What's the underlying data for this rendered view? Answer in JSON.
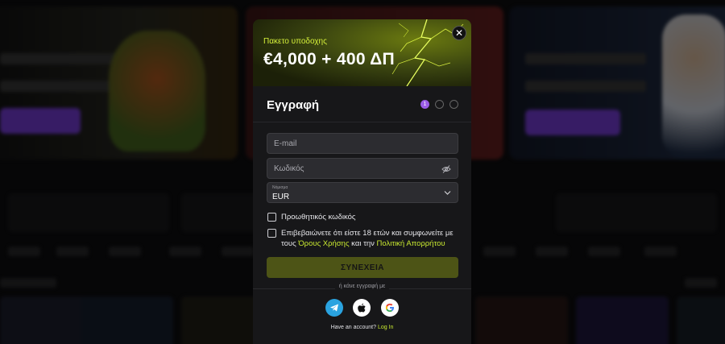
{
  "banner": {
    "subtitle": "Πακετο υποδοχης",
    "title": "€4,000 + 400 ΔΠ",
    "close_symbol": "✕"
  },
  "form": {
    "title": "Εγγραφή",
    "steps": [
      "1",
      "",
      ""
    ],
    "email_placeholder": "E-mail",
    "password_placeholder": "Κωδικός",
    "currency_label": "Νόμισμα",
    "currency_value": "EUR",
    "promo_label": "Προωθητικός κωδικός",
    "terms_text_1": "Επιβεβαιώνετε ότι είστε 18 ετών και συμφωνείτε με τους ",
    "terms_link_1": "Όρους Χρήσης",
    "terms_text_2": " και την ",
    "terms_link_2": "Πολιτική Απορρήτου",
    "continue_label": "ΣΥΝΕΧΕΙΑ"
  },
  "social": {
    "divider_text": "ή κάνε εγγραφή με",
    "providers": [
      "telegram-icon",
      "apple-icon",
      "google-icon"
    ]
  },
  "footer": {
    "account_text": "Have an account? ",
    "login_link": "Log In"
  },
  "colors": {
    "accent": "#c8e830",
    "step_active": "#9a5ce8",
    "continue_bg": "#4d5416"
  }
}
